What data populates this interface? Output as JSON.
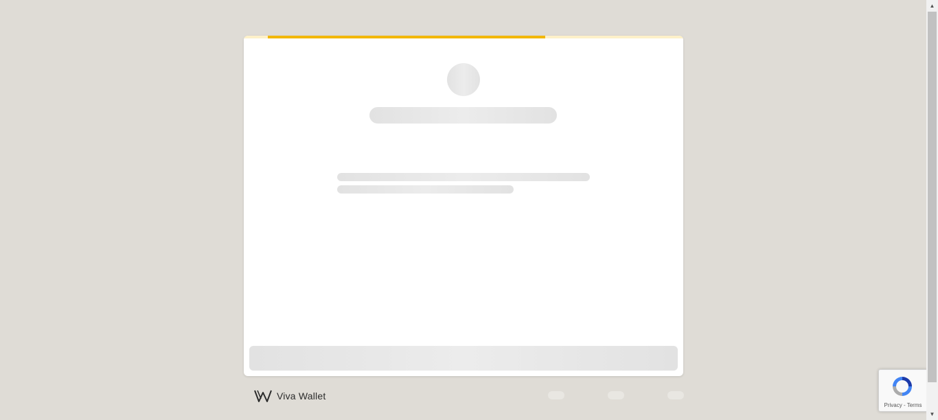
{
  "progress": {
    "fraction": 0.667,
    "track_color": "#fdf1c9",
    "fill_color": "#f2b705"
  },
  "footer": {
    "brand_name": "Viva Wallet",
    "logo_icon": "viva-wallet-logo-icon"
  },
  "recaptcha": {
    "privacy_label": "Privacy",
    "separator": " - ",
    "terms_label": "Terms",
    "icon": "recaptcha-icon"
  },
  "scrollbar": {
    "up_glyph": "▲",
    "down_glyph": "▼"
  }
}
